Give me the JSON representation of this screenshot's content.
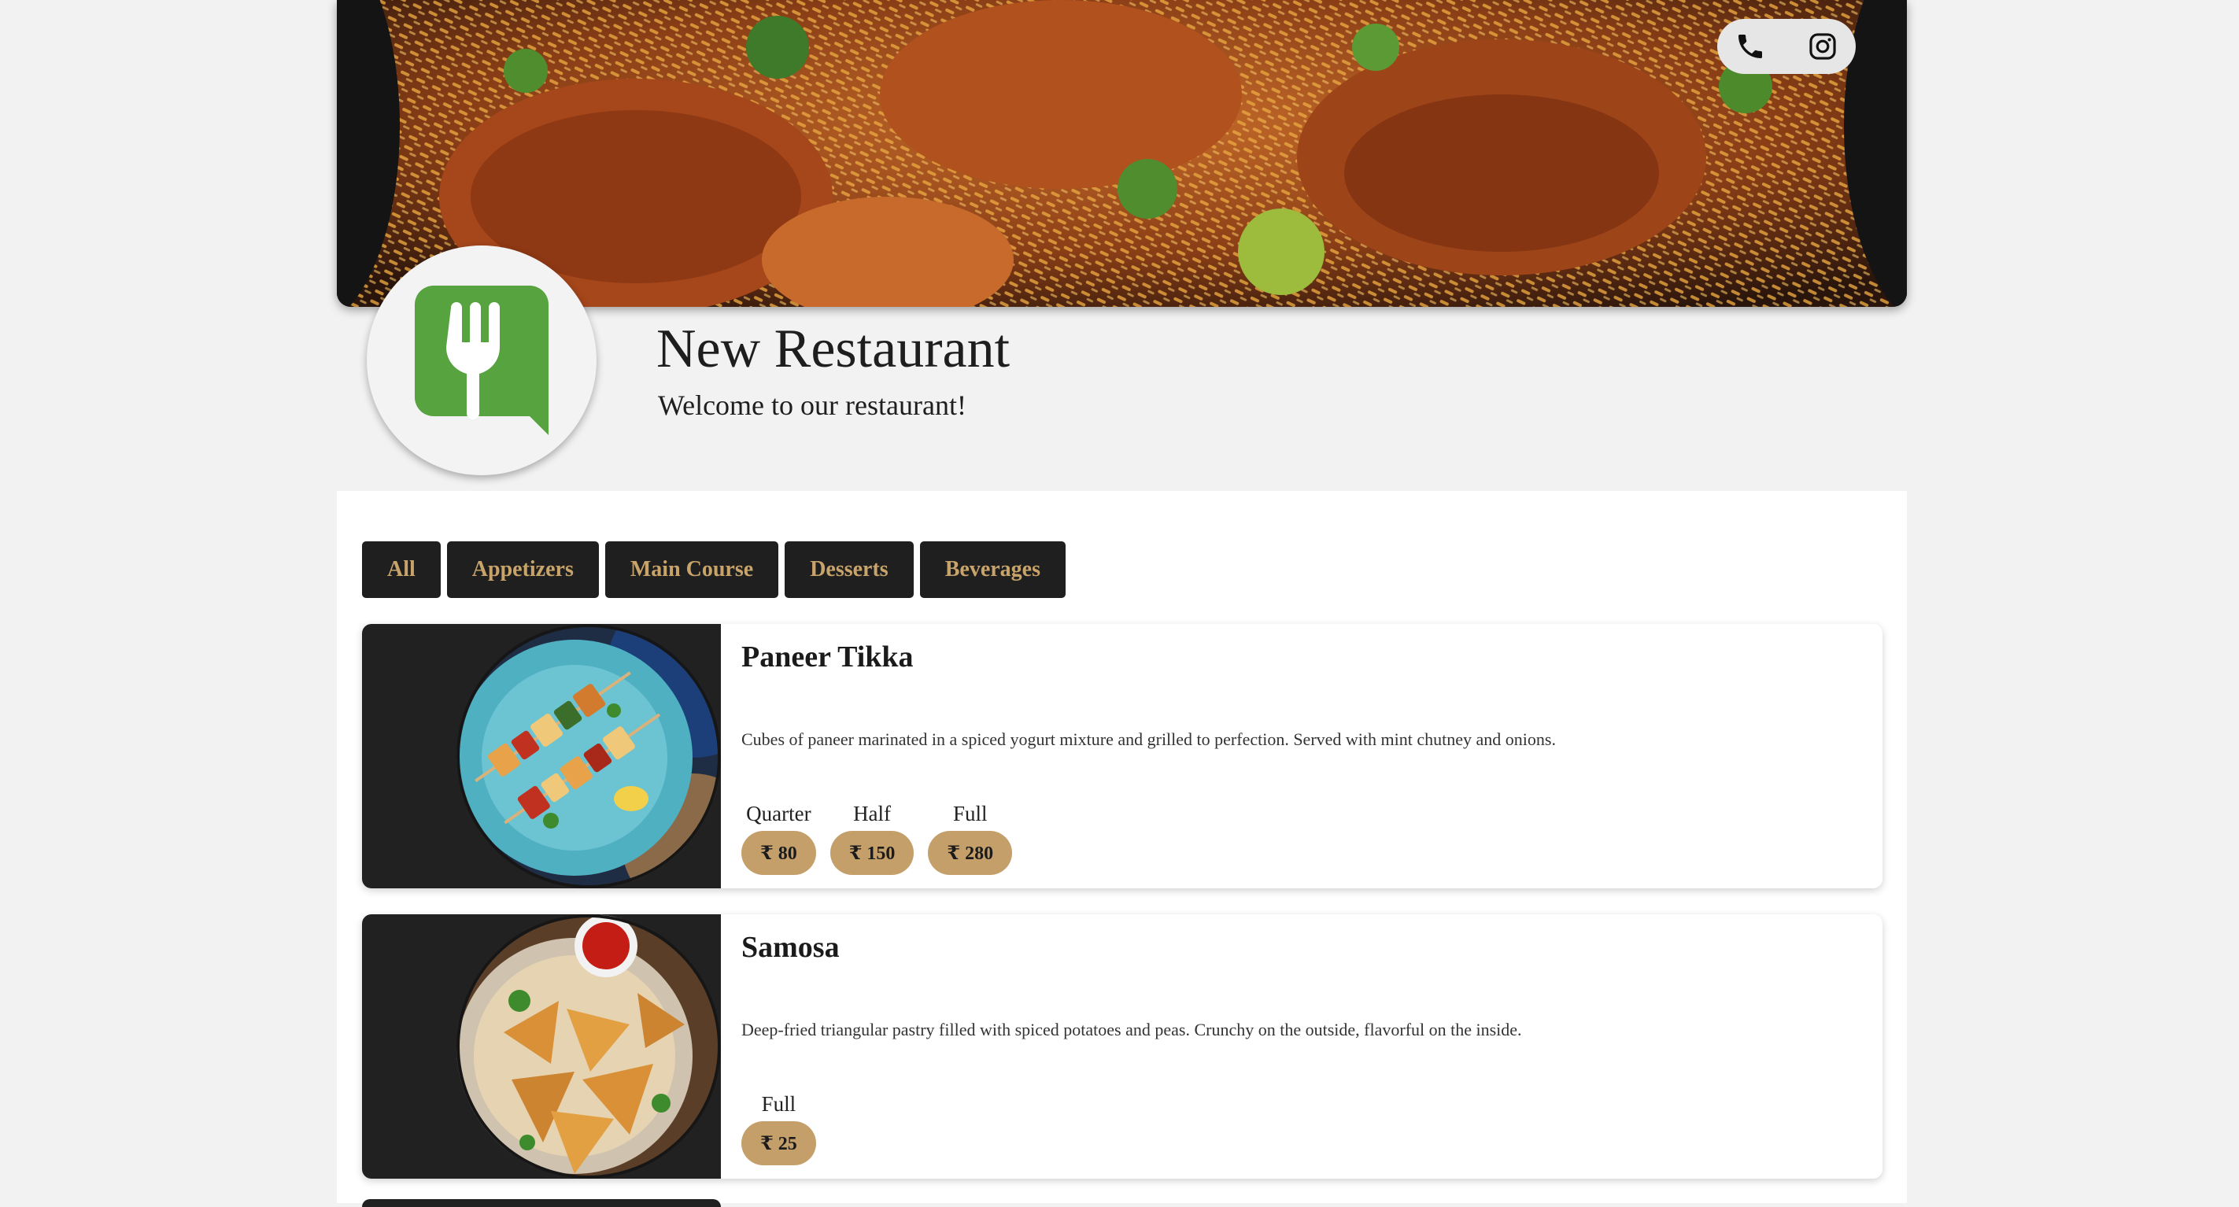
{
  "header": {
    "name": "New Restaurant",
    "tagline": "Welcome to our restaurant!",
    "social": [
      {
        "icon": "phone-icon"
      },
      {
        "icon": "instagram-icon"
      }
    ],
    "brand_color": "#56a33f"
  },
  "menu": {
    "tabs": [
      {
        "label": "All"
      },
      {
        "label": "Appetizers"
      },
      {
        "label": "Main Course"
      },
      {
        "label": "Desserts"
      },
      {
        "label": "Beverages"
      }
    ],
    "items": [
      {
        "name": "Paneer Tikka",
        "description": "Cubes of paneer marinated in a spiced yogurt mixture and grilled to perfection. Served with mint chutney and onions.",
        "prices": [
          {
            "size": "Quarter",
            "price": "₹ 80"
          },
          {
            "size": "Half",
            "price": "₹ 150"
          },
          {
            "size": "Full",
            "price": "₹ 280"
          }
        ]
      },
      {
        "name": "Samosa",
        "description": "Deep-fried triangular pastry filled with spiced potatoes and peas. Crunchy on the outside, flavorful on the inside.",
        "prices": [
          {
            "size": "Full",
            "price": "₹ 25"
          }
        ]
      }
    ]
  },
  "colors": {
    "tab_bg": "#1f1f1f",
    "tab_text": "#c9a46a",
    "price_pill": "#c49f6a"
  }
}
